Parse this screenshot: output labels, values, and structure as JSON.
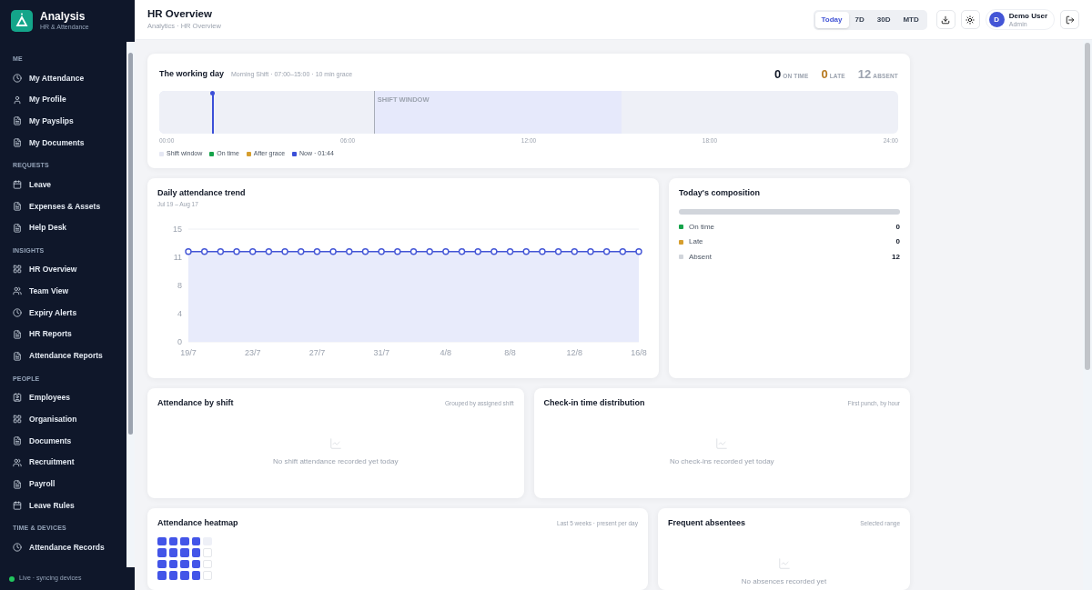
{
  "brand": {
    "title": "Analysis",
    "subtitle": "HR & Attendance"
  },
  "sidebar": {
    "sections": [
      {
        "label": "ME",
        "items": [
          {
            "label": "My Attendance",
            "kind": "clock"
          },
          {
            "label": "My Profile",
            "kind": "user"
          },
          {
            "label": "My Payslips",
            "kind": "file"
          },
          {
            "label": "My Documents",
            "kind": "file"
          }
        ]
      },
      {
        "label": "REQUESTS",
        "items": [
          {
            "label": "Leave",
            "kind": "calendar"
          },
          {
            "label": "Expenses & Assets",
            "kind": "file"
          },
          {
            "label": "Help Desk",
            "kind": "file"
          }
        ]
      },
      {
        "label": "INSIGHTS",
        "items": [
          {
            "label": "HR Overview",
            "kind": "grid"
          },
          {
            "label": "Team View",
            "kind": "users"
          },
          {
            "label": "Expiry Alerts",
            "kind": "clock"
          },
          {
            "label": "HR Reports",
            "kind": "file"
          },
          {
            "label": "Attendance Reports",
            "kind": "file"
          }
        ]
      },
      {
        "label": "PEOPLE",
        "items": [
          {
            "label": "Employees",
            "kind": "card"
          },
          {
            "label": "Organisation",
            "kind": "grid"
          },
          {
            "label": "Documents",
            "kind": "file"
          },
          {
            "label": "Recruitment",
            "kind": "users"
          },
          {
            "label": "Payroll",
            "kind": "file"
          },
          {
            "label": "Leave Rules",
            "kind": "calendar"
          }
        ]
      },
      {
        "label": "TIME & DEVICES",
        "items": [
          {
            "label": "Attendance Records",
            "kind": "clock"
          }
        ]
      }
    ],
    "status": {
      "label": "Live · syncing devices",
      "color": "#22c55e"
    }
  },
  "header": {
    "title": "HR Overview",
    "breadcrumb": "Analytics · HR Overview",
    "ranges": [
      {
        "label": "Today",
        "selected": true
      },
      {
        "label": "7D",
        "selected": false
      },
      {
        "label": "30D",
        "selected": false
      },
      {
        "label": "MTD",
        "selected": false
      }
    ],
    "user": {
      "initial": "D",
      "name": "Demo User",
      "role": "Admin"
    }
  },
  "working_day": {
    "title": "The working day",
    "subtitle": "Morning Shift · 07:00–15:00 · 10 min grace",
    "stats": [
      {
        "value": "0",
        "label": "ON TIME",
        "color": "#111827"
      },
      {
        "value": "0",
        "label": "LATE",
        "color": "#b7791f"
      },
      {
        "value": "12",
        "label": "ABSENT",
        "color": "#9ca3af"
      }
    ],
    "shift_label": "SHIFT WINDOW",
    "shift_start": {
      "level": 0.2917
    },
    "shift_end": {
      "level": 0.625
    },
    "now_marker": {
      "level": 0.0722
    },
    "ticks": [
      "00:00",
      "06:00",
      "12:00",
      "18:00",
      "24:00"
    ],
    "legend": [
      {
        "label": "Shift window",
        "color": "#e5e7f3"
      },
      {
        "label": "On time",
        "color": "#16a34a"
      },
      {
        "label": "After grace",
        "color": "#d69e2e"
      },
      {
        "label": "Now · 01:44",
        "color": "#3b4fd8"
      }
    ]
  },
  "trend": {
    "title": "Daily attendance trend",
    "subtitle": "Jul 19 – Aug 17",
    "chart_data": {
      "type": "area",
      "categories": [
        "19/7",
        null,
        null,
        null,
        "23/7",
        null,
        null,
        null,
        "27/7",
        null,
        null,
        null,
        "31/7",
        null,
        null,
        null,
        "4/8",
        null,
        null,
        null,
        "8/8",
        null,
        null,
        null,
        "12/8",
        null,
        null,
        null,
        "16/8"
      ],
      "series": [
        {
          "color": "#4355d6",
          "values": [
            12,
            12,
            12,
            12,
            12,
            12,
            12,
            12,
            12,
            12,
            12,
            12,
            12,
            12,
            12,
            12,
            12,
            12,
            12,
            12,
            12,
            12,
            12,
            12,
            12,
            12,
            12,
            12,
            12
          ]
        }
      ],
      "ylim": [
        0,
        15
      ],
      "yticks": [
        0,
        {
          "value": 3.75,
          "label": "4"
        },
        {
          "value": 7.5,
          "label": "8"
        },
        {
          "value": 11.25,
          "label": "11"
        },
        15
      ]
    }
  },
  "composition": {
    "title": "Today's composition",
    "items": [
      {
        "label": "On time",
        "count": "0",
        "color": "#16a34a"
      },
      {
        "label": "Late",
        "count": "0",
        "color": "#d69e2e"
      },
      {
        "label": "Absent",
        "count": "12",
        "color": "#d1d5db"
      }
    ]
  },
  "by_shift": {
    "title": "Attendance by shift",
    "note": "Grouped by assigned shift",
    "empty": "No shift attendance recorded yet today"
  },
  "checkin": {
    "title": "Check-in time distribution",
    "note": "First punch, by hour",
    "empty": "No check-ins recorded yet today"
  },
  "heatmap": {
    "title": "Attendance heatmap",
    "note": "Last 5 weeks · present per day",
    "rows": [
      {
        "cells": [
          {
            "kind": "present"
          },
          {
            "kind": "present"
          },
          {
            "kind": "present"
          },
          {
            "kind": "present"
          },
          {
            "kind": "today"
          }
        ]
      },
      {
        "cells": [
          {
            "kind": "present"
          },
          {
            "kind": "present"
          },
          {
            "kind": "present"
          },
          {
            "kind": "present"
          },
          {
            "kind": "none"
          }
        ]
      },
      {
        "cells": [
          {
            "kind": "present"
          },
          {
            "kind": "present"
          },
          {
            "kind": "present"
          },
          {
            "kind": "present"
          },
          {
            "kind": "none"
          }
        ]
      },
      {
        "cells": [
          {
            "kind": "present"
          },
          {
            "kind": "present"
          },
          {
            "kind": "present"
          },
          {
            "kind": "present"
          },
          {
            "kind": "none"
          }
        ]
      }
    ]
  },
  "absentees": {
    "title": "Frequent absentees",
    "note": "Selected range",
    "empty": "No absences recorded yet"
  }
}
